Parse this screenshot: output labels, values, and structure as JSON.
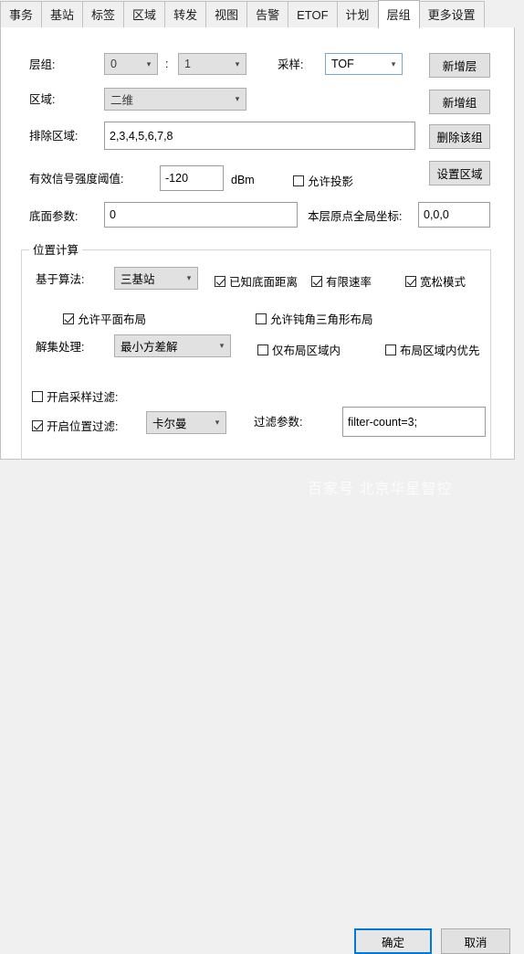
{
  "tabs": [
    {
      "label": "事务",
      "active": false
    },
    {
      "label": "基站",
      "active": false
    },
    {
      "label": "标签",
      "active": false
    },
    {
      "label": "区域",
      "active": false
    },
    {
      "label": "转发",
      "active": false
    },
    {
      "label": "视图",
      "active": false
    },
    {
      "label": "告警",
      "active": false
    },
    {
      "label": "ETOF",
      "active": false
    },
    {
      "label": "计划",
      "active": false
    },
    {
      "label": "层组",
      "active": true
    },
    {
      "label": "更多设置",
      "active": false
    }
  ],
  "form": {
    "layer_group_label": "层组:",
    "layer_group_value": "0",
    "layer_group_separator": ":",
    "layer_index_value": "1",
    "sampling_label": "采样:",
    "sampling_value": "TOF",
    "zone_label": "区域:",
    "zone_value": "二维",
    "exclude_zone_label": "排除区域:",
    "exclude_zone_value": "2,3,4,5,6,7,8",
    "signal_threshold_label": "有效信号强度阈值:",
    "signal_threshold_value": "-120",
    "signal_threshold_unit": "dBm",
    "allow_projection_label": "允许投影",
    "allow_projection_checked": false,
    "ground_param_label": "底面参数:",
    "ground_param_value": "0",
    "origin_global_label": "本层原点全局坐标:",
    "origin_global_value": "0,0,0"
  },
  "buttons": {
    "add_layer": "新增层",
    "add_group": "新增组",
    "delete_group": "删除该组",
    "set_zone": "设置区域"
  },
  "position_calc": {
    "title": "位置计算",
    "algorithm_label": "基于算法:",
    "algorithm_value": "三基站",
    "checks_row1": [
      {
        "label": "已知底面距离",
        "checked": true
      },
      {
        "label": "有限速率",
        "checked": true
      },
      {
        "label": "宽松模式",
        "checked": true
      }
    ],
    "checks_row2": [
      {
        "label": "允许平面布局",
        "checked": true
      },
      {
        "label": "允许钝角三角形布局",
        "checked": false
      }
    ],
    "solve_label": "解集处理:",
    "solve_value": "最小方差解",
    "checks_row3": [
      {
        "label": "仅布局区域内",
        "checked": false
      },
      {
        "label": "布局区域内优先",
        "checked": false
      }
    ],
    "sample_filter_label": "开启采样过滤:",
    "sample_filter_checked": false,
    "position_filter_label": "开启位置过滤:",
    "position_filter_checked": true,
    "position_filter_value": "卡尔曼",
    "filter_param_label": "过滤参数:",
    "filter_param_value": "filter-count=3;"
  },
  "footer": {
    "ok": "确定",
    "cancel": "取消"
  },
  "watermark": "百家号 北京华星智控",
  "icons": {
    "chevron_down": "⌄"
  },
  "colors": {
    "accent": "#0078d7",
    "panel_bg": "#ffffff",
    "window_bg": "#f0f0f0",
    "control_bg": "#e1e1e1",
    "border": "#adadad"
  }
}
